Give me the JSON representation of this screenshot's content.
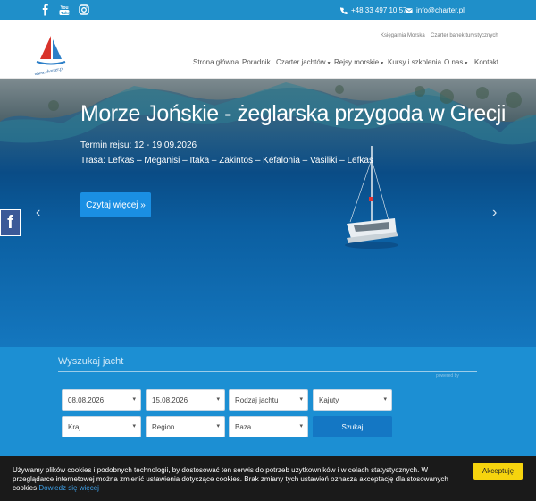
{
  "topbar": {
    "phone": "+48 33 497 10 57",
    "email": "info@charter.pl",
    "social_icons": [
      "facebook-icon",
      "youtube-icon",
      "instagram-icon"
    ]
  },
  "header": {
    "logo_text": "www.charter.pl",
    "top_links": [
      "Księgarnia Morska",
      "Czarter banek turystycznych"
    ],
    "nav": [
      {
        "label": "Strona główna",
        "dropdown": false
      },
      {
        "label": "Poradnik",
        "dropdown": false
      },
      {
        "label": "Czarter jachtów",
        "dropdown": true
      },
      {
        "label": "Rejsy morskie",
        "dropdown": true
      },
      {
        "label": "Kursy i szkolenia",
        "dropdown": false
      },
      {
        "label": "O nas",
        "dropdown": true
      },
      {
        "label": "Kontakt",
        "dropdown": false
      }
    ]
  },
  "hero": {
    "title": "Morze Jońskie - żeglarska przygoda w Grecji",
    "date_line": "Termin rejsu: 12 - 19.09.2026",
    "route_line": "Trasa: Lefkas – Meganisi – Itaka – Zakintos – Kefalonia – Vasiliki – Lefkas",
    "cta": "Czytaj więcej »",
    "prev_arrow": "‹",
    "next_arrow": "›",
    "facebook_tab": "f"
  },
  "search": {
    "title": "Wyszukaj jacht",
    "powered_by": "powered by",
    "fields": {
      "date_from": "08.08.2026",
      "date_to": "15.08.2026",
      "yacht_type": "Rodzaj jachtu",
      "cabins": "Kajuty",
      "country": "Kraj",
      "region": "Region",
      "base": "Baza"
    },
    "button": "Szukaj"
  },
  "cookie": {
    "message": "Używamy plików cookies i podobnych technologii, by dostosować ten serwis do potrzeb użytkowników i w celach statystycznych. W przeglądarce internetowej można zmienić ustawienia dotyczące cookies. Brak zmiany tych ustawień oznacza akceptację dla stosowanych cookies",
    "link": "Dowiedz się więcej",
    "accept": "Akceptuję"
  },
  "colors": {
    "topbar": "#1f8fc9",
    "search_band": "#1c8fd3",
    "cta": "#1a8fe3",
    "cookie_bg": "#1a1a1a",
    "accept": "#f6d40e"
  }
}
